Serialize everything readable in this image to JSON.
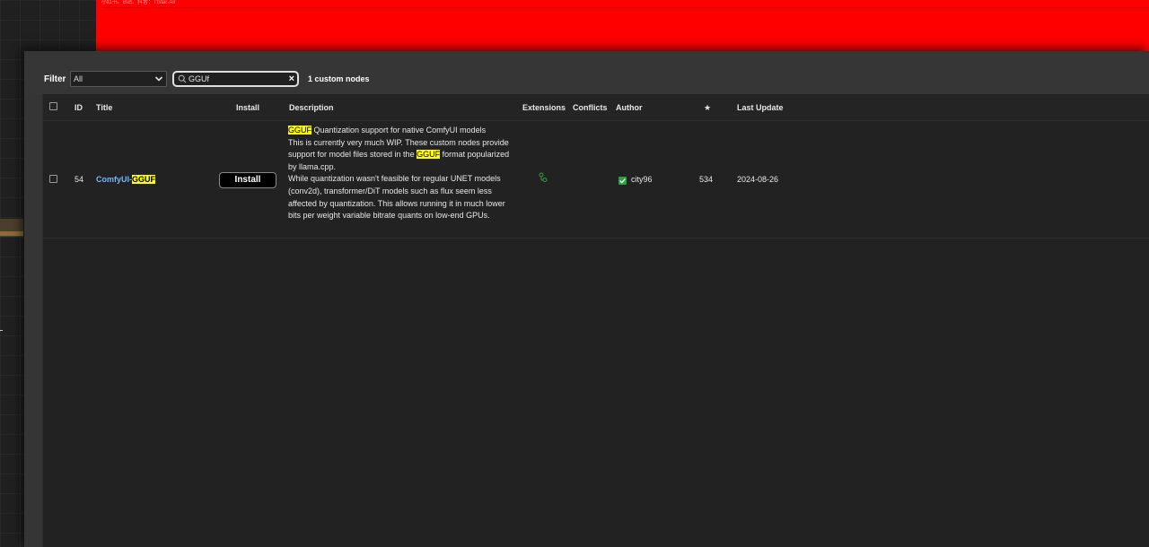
{
  "background": {
    "red_node_title": "小红书、B站、抖音：Tfstar-Air"
  },
  "toolbar": {
    "filter_label": "Filter",
    "filter_value": "All",
    "search_value": "GGUf",
    "result_count": "1 custom nodes"
  },
  "table": {
    "headers": {
      "id": "ID",
      "title": "Title",
      "install": "Install",
      "description": "Description",
      "extensions": "Extensions",
      "conflicts": "Conflicts",
      "author": "Author",
      "stars": "★",
      "last_update": "Last Update"
    },
    "rows": [
      {
        "id": "54",
        "title_prefix": "ComfyUI-",
        "title_highlight": "GGUF",
        "install_label": "Install",
        "description": {
          "p1_highlight": "GGUF",
          "p1_rest": " Quantization support for native ComfyUI models",
          "p2_before": "This is currently very much WIP. These custom nodes provide support for model files stored in the ",
          "p2_highlight": "GGUF",
          "p2_after": " format popularized by llama.cpp.",
          "p3": "While quantization wasn't feasible for regular UNET models (conv2d), transformer/DiT models such as flux seem less affected by quantization. This allows running it in much lower bits per weight variable bitrate quants on low-end GPUs."
        },
        "conflicts": "",
        "author": "city96",
        "stars": "534",
        "last_update": "2024-08-26"
      }
    ]
  },
  "colors": {
    "highlight": "#ffff00",
    "link": "#72b7ff",
    "verified": "#2ea043",
    "canvas_node": "#ff0000"
  },
  "icons": {
    "search": "search-icon",
    "clear": "close-icon",
    "dropdown": "chevron-down-icon",
    "extensions": "extension-nodes-icon",
    "verified": "checkmark-icon"
  }
}
